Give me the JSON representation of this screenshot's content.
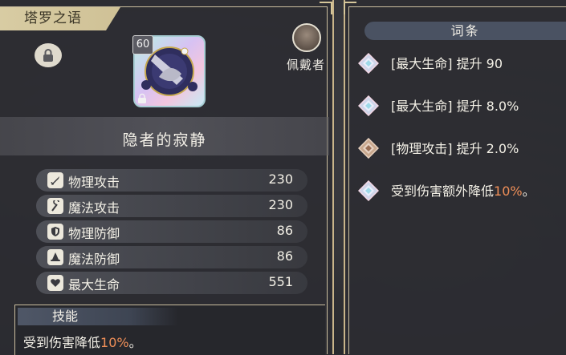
{
  "left": {
    "title": "塔罗之语",
    "level": "60",
    "wearer_label": "佩戴者",
    "item_name": "隐者的寂静",
    "stats": [
      {
        "icon": "sword-icon",
        "label": "物理攻击",
        "value": "230"
      },
      {
        "icon": "wand-icon",
        "label": "魔法攻击",
        "value": "230"
      },
      {
        "icon": "shield-icon",
        "label": "物理防御",
        "value": "86"
      },
      {
        "icon": "wizard-hat-icon",
        "label": "魔法防御",
        "value": "86"
      },
      {
        "icon": "heart-icon",
        "label": "最大生命",
        "value": "551"
      }
    ],
    "skill": {
      "header": "技能",
      "text_prefix": "受到伤害降低",
      "text_highlight": "10%",
      "text_suffix": "。"
    }
  },
  "right": {
    "header": "词条",
    "affixes": [
      {
        "gem": "diamond-gem-icon",
        "text": "[最大生命] 提升 90"
      },
      {
        "gem": "diamond-gem-icon",
        "text": "[最大生命] 提升 8.0%"
      },
      {
        "gem": "bronze-gem-icon",
        "text": "[物理攻击] 提升 2.0%"
      }
    ],
    "special_affix": {
      "gem": "diamond-gem-icon",
      "prefix": "受到伤害额外降低",
      "highlight": "10%",
      "suffix": "。"
    }
  },
  "colors": {
    "frame_gold": "#c9b58a",
    "highlight_orange": "#f08f58",
    "panel_bg": "#2c2d32"
  }
}
